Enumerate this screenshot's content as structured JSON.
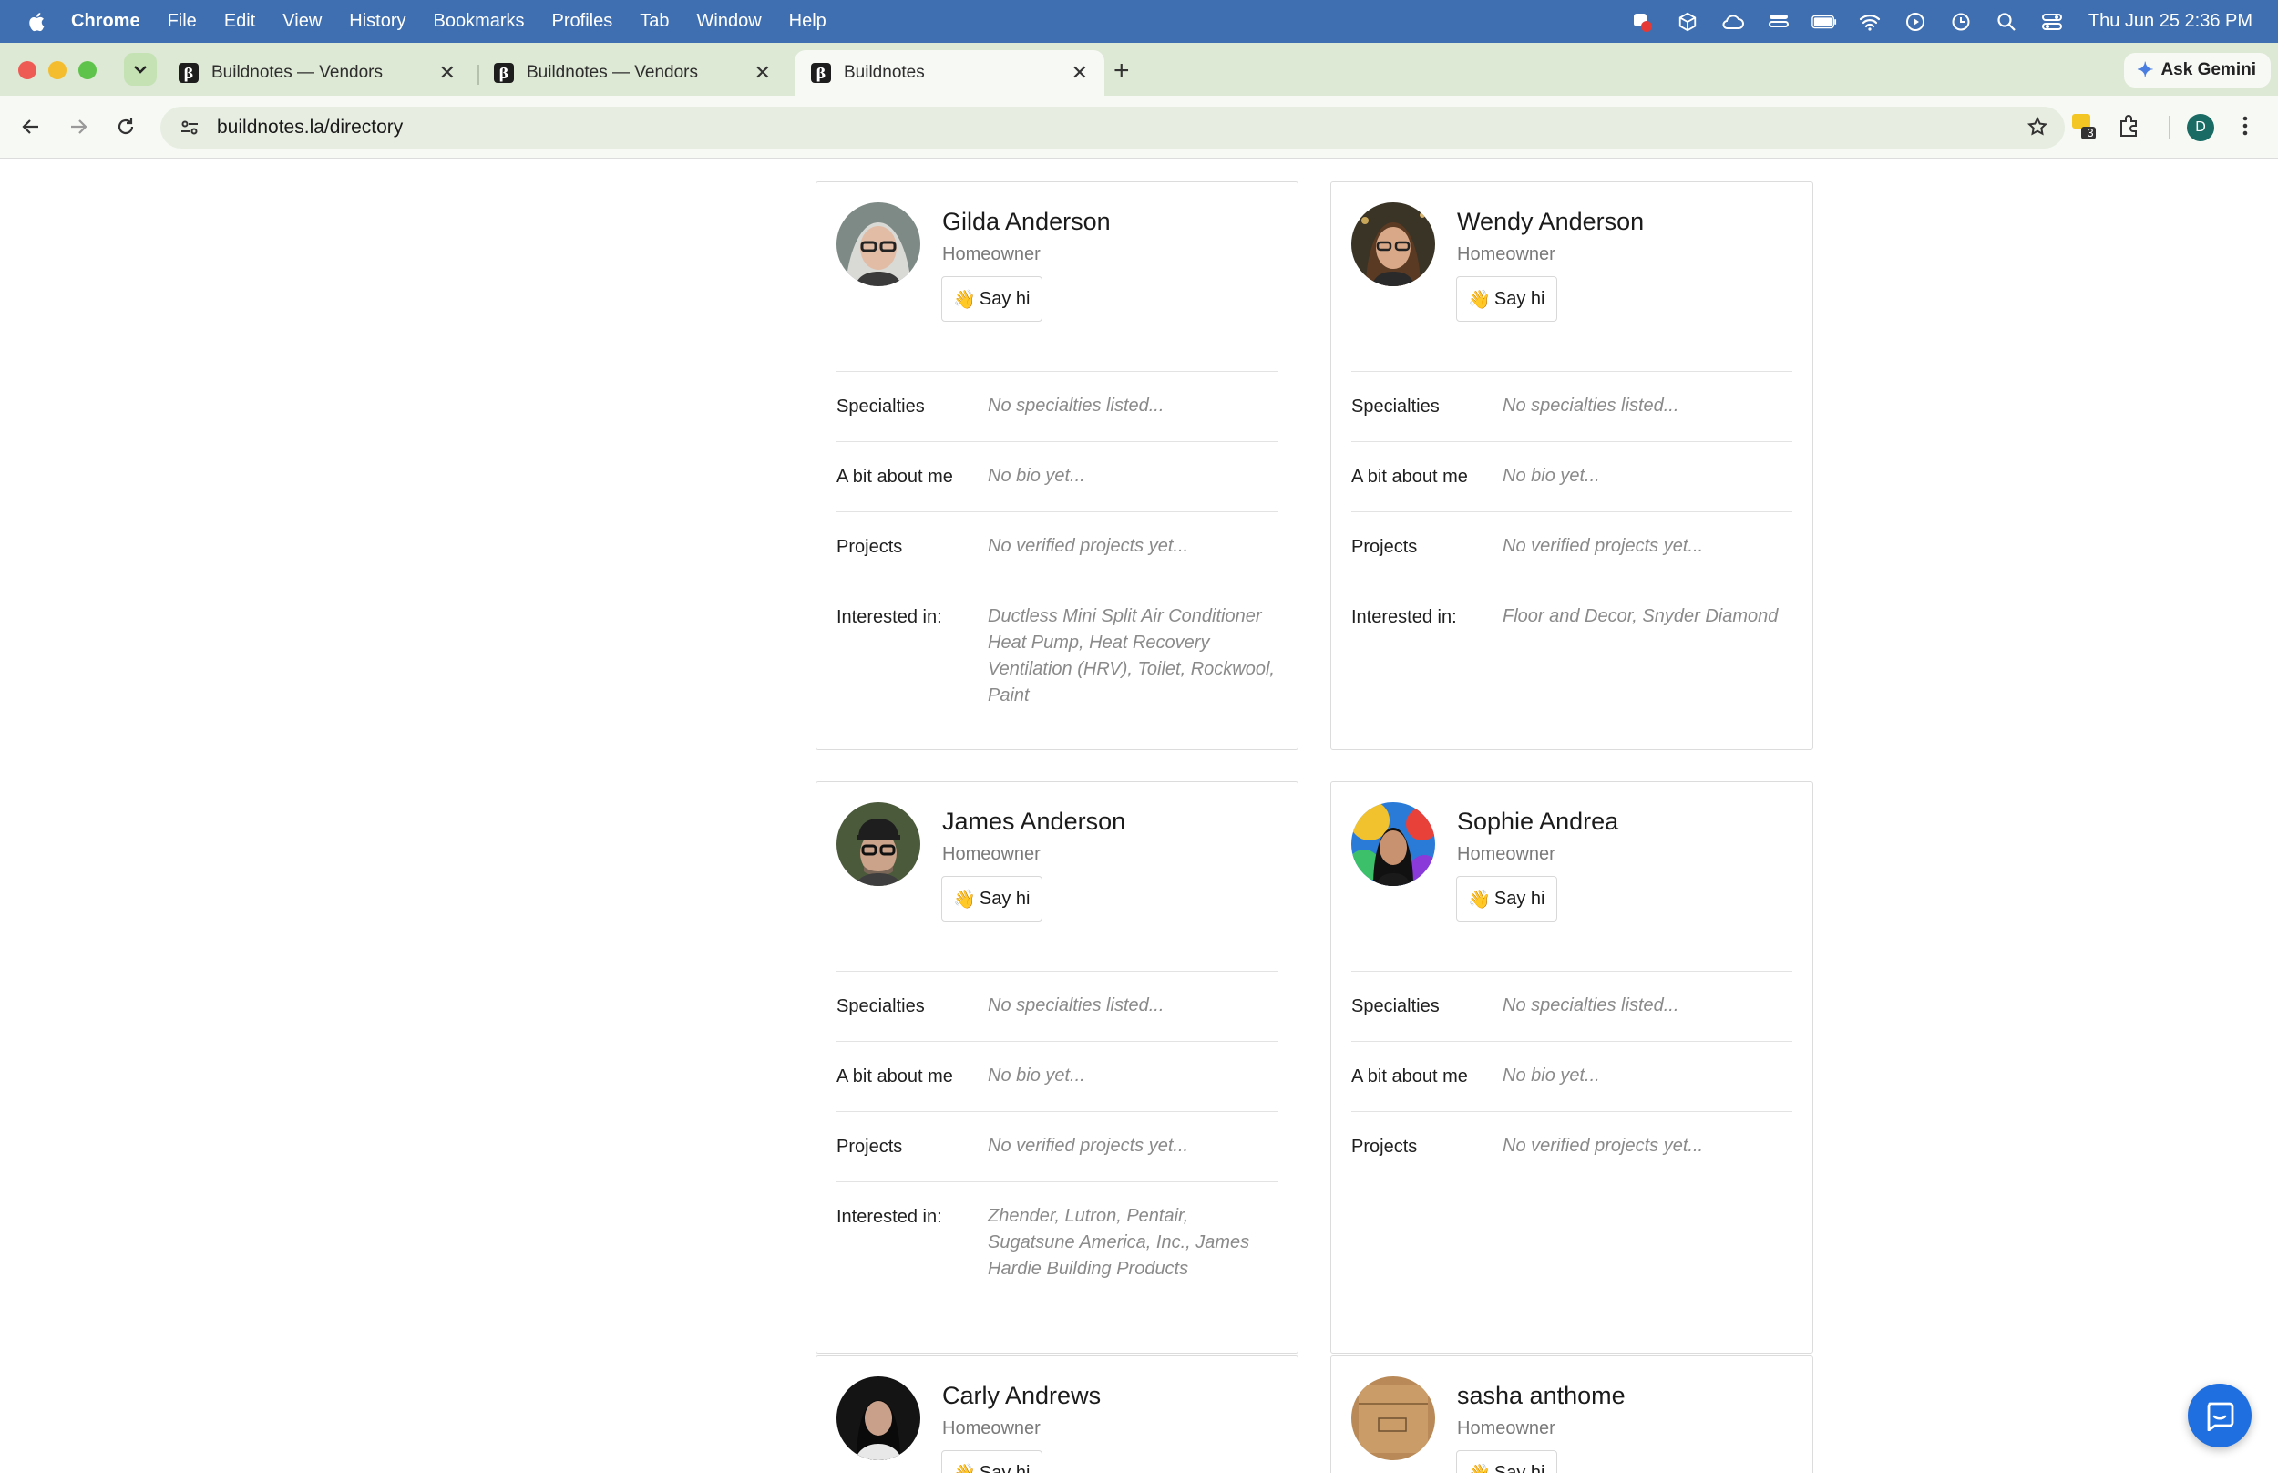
{
  "menubar": {
    "app": "Chrome",
    "items": [
      "File",
      "Edit",
      "View",
      "History",
      "Bookmarks",
      "Profiles",
      "Tab",
      "Window",
      "Help"
    ],
    "clock": "Thu Jun 25  2:36 PM"
  },
  "tabs": [
    {
      "title": "Buildnotes — Vendors",
      "favicon": "β"
    },
    {
      "title": "Buildnotes — Vendors",
      "favicon": "β"
    },
    {
      "title": "Buildnotes",
      "favicon": "β",
      "active": true
    }
  ],
  "gemini": {
    "label": "Ask Gemini"
  },
  "toolbar": {
    "url_host": "buildnotes.la",
    "url_path": "/directory",
    "extension_badge": "3",
    "profile_initial": "D"
  },
  "labels": {
    "specialties": "Specialties",
    "bio": "A bit about me",
    "projects": "Projects",
    "interested": "Interested in:",
    "say_hi": "Say hi",
    "wave": "👋"
  },
  "cards": [
    {
      "name": "Gilda Anderson",
      "role": "Homeowner",
      "specialties": "No specialties listed...",
      "bio": "No bio yet...",
      "projects": "No verified projects yet...",
      "interested": "Ductless Mini Split Air Conditioner Heat Pump, Heat Recovery Ventilation (HRV), Toilet, Rockwool, Paint"
    },
    {
      "name": "Wendy Anderson",
      "role": "Homeowner",
      "specialties": "No specialties listed...",
      "bio": "No bio yet...",
      "projects": "No verified projects yet...",
      "interested": "Floor and Decor, Snyder Diamond"
    },
    {
      "name": "James Anderson",
      "role": "Homeowner",
      "specialties": "No specialties listed...",
      "bio": "No bio yet...",
      "projects": "No verified projects yet...",
      "interested": "Zhender, Lutron, Pentair, Sugatsune America, Inc., James Hardie Building Products"
    },
    {
      "name": "Sophie Andrea",
      "role": "Homeowner",
      "specialties": "No specialties listed...",
      "bio": "No bio yet...",
      "projects": "No verified projects yet..."
    },
    {
      "name": "Carly Andrews",
      "role": "Homeowner"
    },
    {
      "name": "sasha anthome",
      "role": "Homeowner"
    }
  ],
  "colors": {
    "menubar": "#3f6fb0",
    "tabstrip": "#dde8d5",
    "chat_button": "#1f6fe0"
  }
}
